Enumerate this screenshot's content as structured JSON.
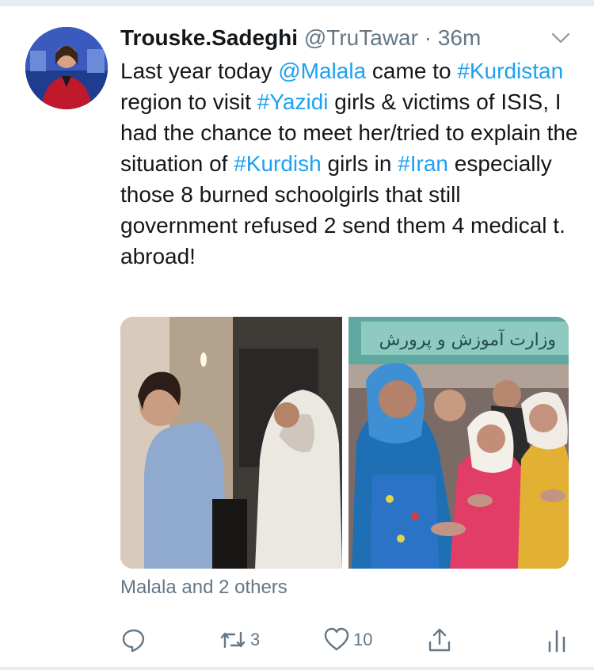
{
  "tweet": {
    "author": {
      "display_name": "Trouske.Sadeghi",
      "handle": "@TruTawar",
      "separator": "·",
      "time": "36m",
      "avatar_icon": "avatar-photo"
    },
    "text_segments": [
      {
        "t": "Last year today ",
        "link": false
      },
      {
        "t": "@Malala",
        "link": true
      },
      {
        "t": " came to ",
        "link": false
      },
      {
        "t": "#Kurdistan",
        "link": true
      },
      {
        "t": " region to visit ",
        "link": false
      },
      {
        "t": "#Yazidi",
        "link": true
      },
      {
        "t": " girls & victims of ISIS, I had the chance to meet her/tried to explain the situation of ",
        "link": false
      },
      {
        "t": "#Kurdish",
        "link": true
      },
      {
        "t": " girls in ",
        "link": false
      },
      {
        "t": "#Iran",
        "link": true
      },
      {
        "t": " especially those 8 burned schoolgirls that still government refused 2 send them 4 medical t. abroad!",
        "link": false
      }
    ],
    "media": {
      "photos": [
        "photo-left",
        "photo-right"
      ],
      "sign_text": "وزارت آموزش و پرورش"
    },
    "tagged_text": "Malala and 2 others",
    "actions": {
      "reply_count": "",
      "retweet_count": "3",
      "like_count": "10",
      "share_count": "",
      "analytics_count": ""
    }
  },
  "colors": {
    "link": "#1da1f2",
    "secondary": "#657786",
    "primary_text": "#14171a"
  }
}
